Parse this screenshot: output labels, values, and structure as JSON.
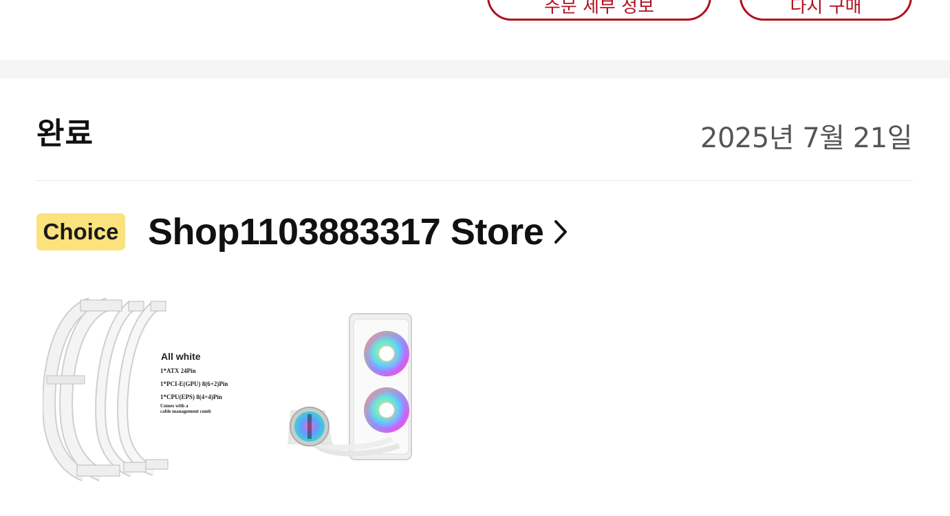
{
  "top_buttons": [
    {
      "label": "주문 세부 정보"
    },
    {
      "label": "다시 구매"
    }
  ],
  "order": {
    "status": "완료",
    "date": "2025년 7월 21일"
  },
  "store": {
    "badge": "Choice",
    "name": "Shop1103883317 Store"
  },
  "products": [
    {
      "icon": "psu-extension-cable-image",
      "caption_title": "All white",
      "caption_lines": [
        "1*ATX 24Pin",
        "1*PCI-E(GPU) 8(6+2)Pin",
        "1*CPU(EPS) 8(4+4)Pin",
        "Comes with a",
        "cable management comb"
      ]
    },
    {
      "icon": "aio-liquid-cooler-image"
    }
  ],
  "colors": {
    "accent": "#b0101e",
    "choice_badge": "#fbe27e",
    "band": "#f5f5f5"
  }
}
